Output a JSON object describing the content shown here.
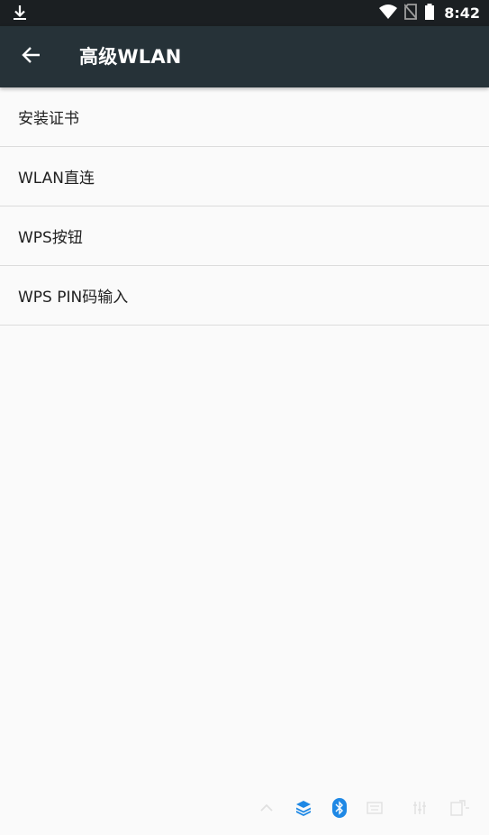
{
  "status_bar": {
    "time": "8:42",
    "icons": [
      "download-icon",
      "wifi-icon",
      "no-sim-icon",
      "battery-icon"
    ]
  },
  "app_bar": {
    "title": "高级WLAN",
    "back_icon": "arrow-back-icon"
  },
  "settings": {
    "items": [
      {
        "label": "安装证书"
      },
      {
        "label": "WLAN直连"
      },
      {
        "label": "WPS按钮"
      },
      {
        "label": "WPS PIN码输入"
      }
    ]
  },
  "tray_icons": [
    "chevron-up-icon",
    "layers-icon",
    "bluetooth-icon",
    "keyboard-icon",
    "tune-icon",
    "screen-rotation-icon"
  ],
  "colors": {
    "app_bar": "#263238",
    "status_bar": "#1b1f22",
    "background": "#fafafa",
    "accent_blue": "#1e88e5"
  }
}
